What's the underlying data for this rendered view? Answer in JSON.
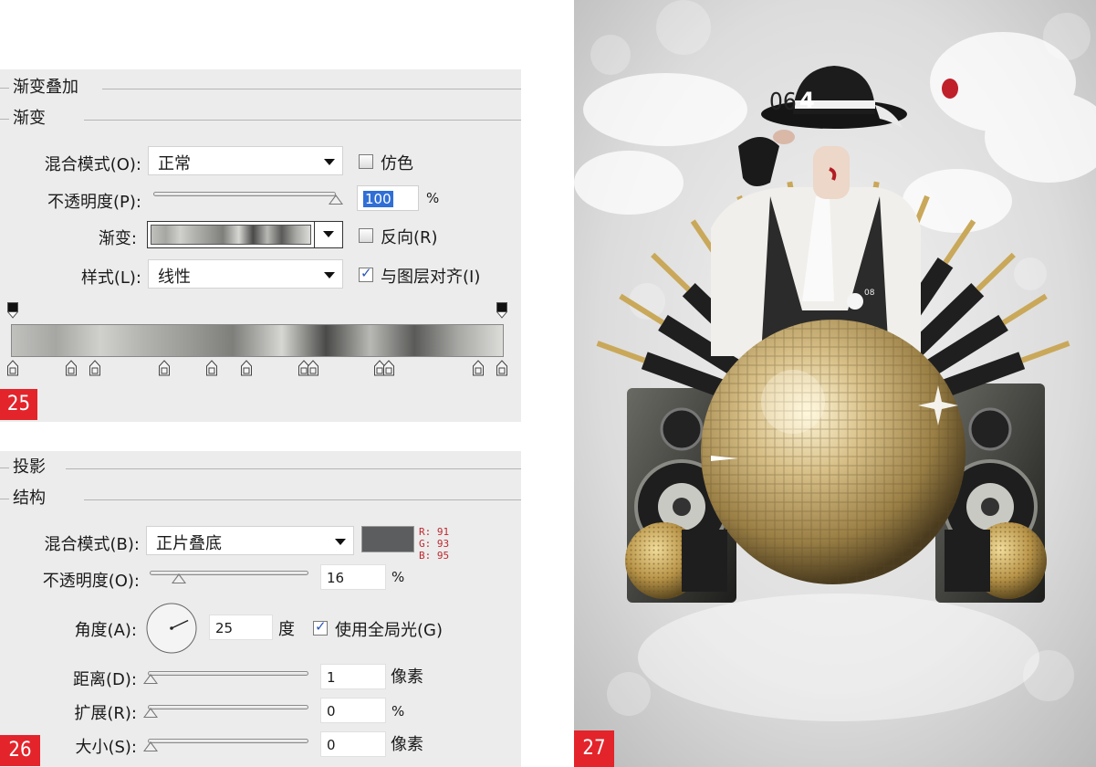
{
  "gradient_panel": {
    "group_title": "渐变叠加",
    "sub_title": "渐变",
    "blend_mode_label": "混合模式(O):",
    "blend_mode_value": "正常",
    "dither_label": "仿色",
    "opacity_label": "不透明度(P):",
    "opacity_value": "100",
    "opacity_unit": "%",
    "gradient_label": "渐变:",
    "reverse_label": "反向(R)",
    "style_label": "样式(L):",
    "style_value": "线性",
    "align_label": "与图层对齐(I)",
    "dither_checked": false,
    "reverse_checked": false,
    "align_checked": true,
    "opacity_level": 1.0,
    "gradient_colors": [
      "#c0c0bd",
      "#a6a6a3",
      "#d0d0cc",
      "#b2b2ae",
      "#9a9a96",
      "#7e7e7b",
      "#d6d6d3",
      "#4a4a48",
      "#b8b8b5",
      "#5a5a58",
      "#a8a8a5",
      "#dcdcd9"
    ],
    "badge": "25"
  },
  "shadow_panel": {
    "group_title": "投影",
    "sub_title": "结构",
    "blend_mode_label": "混合模式(B):",
    "blend_mode_value": "正片叠底",
    "swatch_color": "#5b5d5f",
    "rgb_r": "R: 91",
    "rgb_g": "G: 93",
    "rgb_b": "B: 95",
    "opacity_label": "不透明度(O):",
    "opacity_value": "16",
    "opacity_unit": "%",
    "opacity_level": 0.16,
    "angle_label": "角度(A):",
    "angle_value": "25",
    "angle_unit": "度",
    "global_light_label": "使用全局光(G)",
    "global_light_checked": true,
    "distance_label": "距离(D):",
    "distance_value": "1",
    "distance_unit": "像素",
    "spread_label": "扩展(R):",
    "spread_value": "0",
    "spread_unit": "%",
    "size_label": "大小(S):",
    "size_value": "0",
    "size_unit": "像素",
    "badge": "26"
  },
  "poster": {
    "badge": "27",
    "number_text": "06",
    "number_text_2": "4",
    "small_label": "08",
    "colors": {
      "gold": "#c9a85a",
      "black": "#1b1b1b",
      "red": "#c0202a"
    }
  }
}
